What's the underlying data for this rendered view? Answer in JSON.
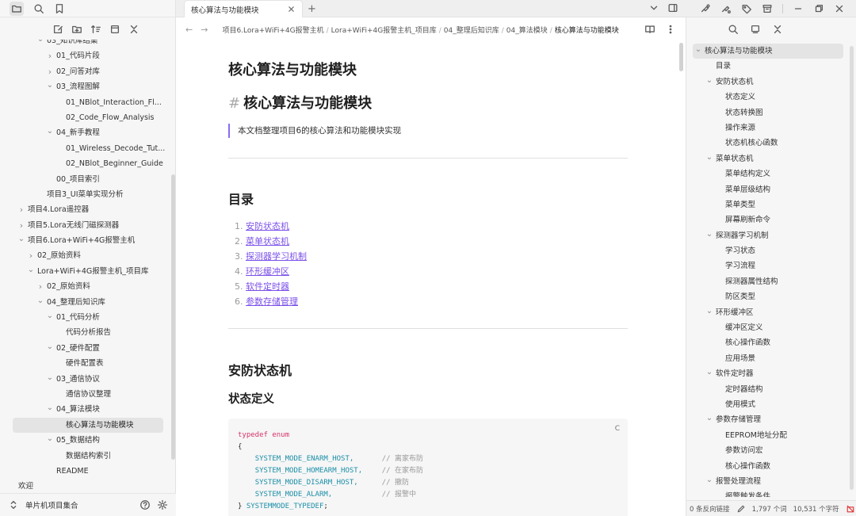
{
  "left_sidebar": {
    "vault_name": "单片机项目集合",
    "tree": [
      {
        "label": "03_知识库结集",
        "level": 3,
        "chevron": "down",
        "partial": true
      },
      {
        "label": "01_代码片段",
        "level": 4,
        "chevron": "right"
      },
      {
        "label": "02_问答对库",
        "level": 4,
        "chevron": "right"
      },
      {
        "label": "03_流程图解",
        "level": 4,
        "chevron": "down"
      },
      {
        "label": "01_NBlot_Interaction_Fl...",
        "level": 5,
        "chevron": ""
      },
      {
        "label": "02_Code_Flow_Analysis",
        "level": 5,
        "chevron": ""
      },
      {
        "label": "04_新手教程",
        "level": 4,
        "chevron": "down"
      },
      {
        "label": "01_Wireless_Decode_Tut...",
        "level": 5,
        "chevron": ""
      },
      {
        "label": "02_NBlot_Beginner_Guide",
        "level": 5,
        "chevron": ""
      },
      {
        "label": "00_项目索引",
        "level": 4,
        "chevron": ""
      },
      {
        "label": "项目3_UI菜单实现分析",
        "level": 3,
        "chevron": ""
      },
      {
        "label": "项目4.Lora遥控器",
        "level": 1,
        "chevron": "right"
      },
      {
        "label": "项目5.Lora无线门磁探测器",
        "level": 1,
        "chevron": "right"
      },
      {
        "label": "项目6.Lora+WiFi+4G报警主机",
        "level": 1,
        "chevron": "down"
      },
      {
        "label": "02_原始资料",
        "level": 2,
        "chevron": "right"
      },
      {
        "label": "Lora+WiFi+4G报警主机_项目库",
        "level": 2,
        "chevron": "down"
      },
      {
        "label": "02_原始资料",
        "level": 3,
        "chevron": "right"
      },
      {
        "label": "04_整理后知识库",
        "level": 3,
        "chevron": "down"
      },
      {
        "label": "01_代码分析",
        "level": 4,
        "chevron": "down"
      },
      {
        "label": "代码分析报告",
        "level": 5,
        "chevron": ""
      },
      {
        "label": "02_硬件配置",
        "level": 4,
        "chevron": "down"
      },
      {
        "label": "硬件配置表",
        "level": 5,
        "chevron": ""
      },
      {
        "label": "03_通信协议",
        "level": 4,
        "chevron": "down"
      },
      {
        "label": "通信协议整理",
        "level": 5,
        "chevron": ""
      },
      {
        "label": "04_算法模块",
        "level": 4,
        "chevron": "down"
      },
      {
        "label": "核心算法与功能模块",
        "level": 5,
        "chevron": "",
        "active": true
      },
      {
        "label": "05_数据结构",
        "level": 4,
        "chevron": "down"
      },
      {
        "label": "数据结构索引",
        "level": 5,
        "chevron": ""
      },
      {
        "label": "README",
        "level": 4,
        "chevron": ""
      },
      {
        "label": "欢迎",
        "level": 0,
        "chevron": "",
        "partial": true
      }
    ]
  },
  "tab": {
    "title": "核心算法与功能模块"
  },
  "breadcrumb": [
    "项目6.Lora+WiFi+4G报警主机",
    "Lora+WiFi+4G报警主机_项目库",
    "04_整理后知识库",
    "04_算法模块",
    "核心算法与功能模块"
  ],
  "doc": {
    "inline_title": "核心算法与功能模块",
    "h1_hash": "#",
    "h1": "核心算法与功能模块",
    "quote": "本文档整理项目6的核心算法和功能模块实现",
    "toc_heading": "目录",
    "toc": [
      {
        "num": "1.",
        "label": "安防状态机"
      },
      {
        "num": "2.",
        "label": "菜单状态机"
      },
      {
        "num": "3.",
        "label": "探测器学习机制"
      },
      {
        "num": "4.",
        "label": "环形缓冲区"
      },
      {
        "num": "5.",
        "label": "软件定时器"
      },
      {
        "num": "6.",
        "label": "参数存储管理"
      }
    ],
    "section_heading": "安防状态机",
    "sub_heading": "状态定义",
    "code": {
      "copy_glyph": "C",
      "l1_kw": "typedef enum",
      "l2": "{",
      "l3_mac": "SYSTEM_MODE_ENARM_HOST,",
      "l3_cmt": "// 离家布防",
      "l4_mac": "SYSTEM_MODE_HOMEARM_HOST,",
      "l4_cmt": "// 在家布防",
      "l5_mac": "SYSTEM_MODE_DISARM_HOST,",
      "l5_cmt": "// 撤防",
      "l6_mac": "SYSTEM_MODE_ALARM,",
      "l6_cmt": "// 报警中",
      "l7_brace": "} ",
      "l7_mac": "SYSTEMMODE_TYPEDEF",
      "l7_semi": ";"
    }
  },
  "outline": [
    {
      "label": "核心算法与功能模块",
      "level": 0,
      "chevron": "down",
      "active": true
    },
    {
      "label": "目录",
      "level": 1,
      "chevron": ""
    },
    {
      "label": "安防状态机",
      "level": 1,
      "chevron": "down"
    },
    {
      "label": "状态定义",
      "level": 2,
      "chevron": ""
    },
    {
      "label": "状态转换图",
      "level": 2,
      "chevron": ""
    },
    {
      "label": "操作来源",
      "level": 2,
      "chevron": ""
    },
    {
      "label": "状态机核心函数",
      "level": 2,
      "chevron": ""
    },
    {
      "label": "菜单状态机",
      "level": 1,
      "chevron": "down"
    },
    {
      "label": "菜单结构定义",
      "level": 2,
      "chevron": ""
    },
    {
      "label": "菜单层级结构",
      "level": 2,
      "chevron": ""
    },
    {
      "label": "菜单类型",
      "level": 2,
      "chevron": ""
    },
    {
      "label": "屏幕刷新命令",
      "level": 2,
      "chevron": ""
    },
    {
      "label": "探测器学习机制",
      "level": 1,
      "chevron": "down"
    },
    {
      "label": "学习状态",
      "level": 2,
      "chevron": ""
    },
    {
      "label": "学习流程",
      "level": 2,
      "chevron": ""
    },
    {
      "label": "探测器属性结构",
      "level": 2,
      "chevron": ""
    },
    {
      "label": "防区类型",
      "level": 2,
      "chevron": ""
    },
    {
      "label": "环形缓冲区",
      "level": 1,
      "chevron": "down"
    },
    {
      "label": "缓冲区定义",
      "level": 2,
      "chevron": ""
    },
    {
      "label": "核心操作函数",
      "level": 2,
      "chevron": ""
    },
    {
      "label": "应用场景",
      "level": 2,
      "chevron": ""
    },
    {
      "label": "软件定时器",
      "level": 1,
      "chevron": "down"
    },
    {
      "label": "定时器结构",
      "level": 2,
      "chevron": ""
    },
    {
      "label": "使用模式",
      "level": 2,
      "chevron": ""
    },
    {
      "label": "参数存储管理",
      "level": 1,
      "chevron": "down"
    },
    {
      "label": "EEPROM地址分配",
      "level": 2,
      "chevron": ""
    },
    {
      "label": "参数访问宏",
      "level": 2,
      "chevron": ""
    },
    {
      "label": "核心操作函数",
      "level": 2,
      "chevron": ""
    },
    {
      "label": "报警处理流程",
      "level": 1,
      "chevron": "down"
    },
    {
      "label": "报警触发条件",
      "level": 2,
      "chevron": "",
      "partial": true
    }
  ],
  "status_bar": {
    "backlinks": "0 条反向链接",
    "words": "1,797 个词",
    "chars": "10,531 个字符"
  },
  "colors": {
    "link": "#7a4fe8",
    "quote_border": "#8b6cf5",
    "code_keyword": "#d6336c",
    "code_macro": "#1c8fa8",
    "status_error": "#e03131"
  }
}
